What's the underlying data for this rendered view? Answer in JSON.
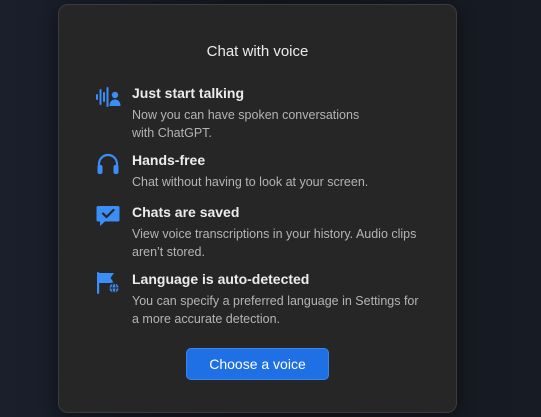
{
  "dialog": {
    "title": "Chat with voice",
    "features": [
      {
        "icon": "voice-user-icon",
        "title": "Just start talking",
        "description": "Now you can have spoken conversations with ChatGPT."
      },
      {
        "icon": "headphones-icon",
        "title": "Hands-free",
        "description": "Chat without having to look at your screen."
      },
      {
        "icon": "chat-check-icon",
        "title": "Chats are saved",
        "description": "View voice transcriptions in your history. Audio clips aren’t stored."
      },
      {
        "icon": "flag-globe-icon",
        "title": "Language is auto-detected",
        "description": "You can specify a preferred language in Settings for a more accurate detection."
      }
    ],
    "button_label": "Choose a voice"
  },
  "colors": {
    "accent": "#1f6fe5",
    "icon": "#3b8ef6",
    "dialog_bg": "#262626"
  }
}
